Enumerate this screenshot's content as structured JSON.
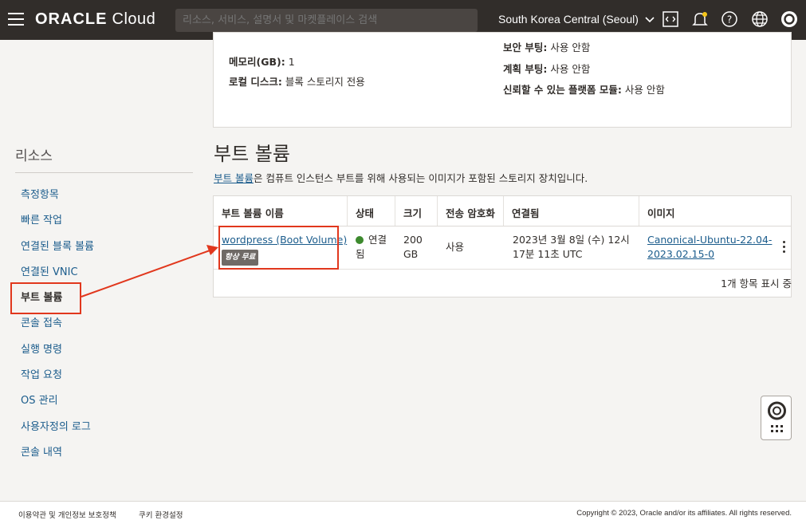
{
  "header": {
    "brand_bold": "ORACLE",
    "brand_light": "Cloud",
    "search_placeholder": "리소스, 서비스, 설명서 및 마켓플레이스 검색",
    "region": "South Korea Central (Seoul)"
  },
  "instance_info": {
    "left": [
      {
        "key": "메모리(GB):",
        "value": "1"
      },
      {
        "key": "로컬 디스크:",
        "value": "블록 스토리지 전용"
      }
    ],
    "right": [
      {
        "key": "보안 부팅:",
        "value": "사용 안함"
      },
      {
        "key": "계획 부팅:",
        "value": "사용 안함"
      },
      {
        "key": "신뢰할 수 있는 플랫폼 모듈:",
        "value": "사용 안함"
      }
    ]
  },
  "sidebar": {
    "title": "리소스",
    "items": [
      {
        "label": "측정항목"
      },
      {
        "label": "빠른 작업"
      },
      {
        "label": "연결된 블록 볼륨"
      },
      {
        "label": "연결된 VNIC"
      },
      {
        "label": "부트 볼륨"
      },
      {
        "label": "콘솔 접속"
      },
      {
        "label": "실행 명령"
      },
      {
        "label": "작업 요청"
      },
      {
        "label": "OS 관리"
      },
      {
        "label": "사용자정의 로그"
      },
      {
        "label": "콘솔 내역"
      }
    ]
  },
  "boot_volumes": {
    "title": "부트 볼륨",
    "desc_link": "부트 볼륨",
    "desc_rest": "은 컴퓨트 인스턴스 부트를 위해 사용되는 이미지가 포함된 스토리지 장치입니다.",
    "columns": [
      "부트 볼륨 이름",
      "상태",
      "크기",
      "전송 암호화",
      "연결됨",
      "이미지"
    ],
    "rows": [
      {
        "name": "wordpress (Boot Volume)",
        "badge": "항상 무료",
        "status_line1": "연결",
        "status_line2": "됨",
        "size_line1": "200",
        "size_line2": "GB",
        "encryption": "사용",
        "attached_line1": "2023년 3월 8일 (수) 12시",
        "attached_line2": "17분 11초 UTC",
        "image_line1": "Canonical-Ubuntu-22.04-",
        "image_line2": "2023.02.15-0"
      }
    ],
    "count_text": "1개 항목 표시 중"
  },
  "footer": {
    "terms": "이용약관 및 개인정보 보호정책",
    "cookies": "쿠키 환경설정",
    "copyright": "Copyright © 2023, Oracle and/or its affiliates. All rights reserved."
  },
  "colors": {
    "topbar": "#312d2a",
    "link": "#1b5c8c",
    "highlight": "#e1371d",
    "status_green": "#3d8a2e"
  }
}
